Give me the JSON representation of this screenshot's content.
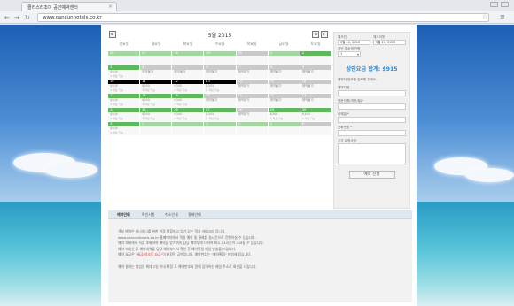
{
  "browser": {
    "tab_title": "콜리스라조이 공인예약센터",
    "url": "www.cancunhotels.co.kr"
  },
  "calendar": {
    "title": "5월 2015",
    "prev_label": "◂",
    "next_label": "▸",
    "today_label": "▸",
    "days": [
      "일요일",
      "월요일",
      "화요일",
      "수요일",
      "목요일",
      "금요일",
      "토요일"
    ],
    "weeks": [
      [
        {
          "d": "26",
          "s": "lg",
          "a": "",
          "b": ""
        },
        {
          "d": "27",
          "s": "lg",
          "a": "",
          "b": ""
        },
        {
          "d": "28",
          "s": "lg",
          "a": "",
          "b": ""
        },
        {
          "d": "29",
          "s": "lg",
          "a": "",
          "b": ""
        },
        {
          "d": "30",
          "s": "",
          "a": "",
          "b": ""
        },
        {
          "d": "1",
          "s": "lg",
          "a": "",
          "b": ""
        },
        {
          "d": "2",
          "s": "g",
          "a": "",
          "b": ""
        }
      ],
      [
        {
          "d": "3",
          "s": "g",
          "a": "$305",
          "b": "3 객실 가능"
        },
        {
          "d": "4",
          "s": "",
          "a": "예약불가",
          "b": ""
        },
        {
          "d": "5",
          "s": "",
          "a": "예약불가",
          "b": ""
        },
        {
          "d": "6",
          "s": "",
          "a": "예약불가",
          "b": ""
        },
        {
          "d": "7",
          "s": "",
          "a": "예약불가",
          "b": ""
        },
        {
          "d": "8",
          "s": "",
          "a": "예약불가",
          "b": ""
        },
        {
          "d": "9",
          "s": "",
          "a": "예약불가",
          "b": ""
        }
      ],
      [
        {
          "d": "10",
          "s": "b",
          "a": "$305",
          "b": "3 객실 가능"
        },
        {
          "d": "11",
          "s": "b",
          "a": "$305",
          "b": "3 객실 가능"
        },
        {
          "d": "12",
          "s": "b",
          "a": "$305",
          "b": "3 객실 가능"
        },
        {
          "d": "13",
          "s": "b",
          "a": "$305",
          "b": "3 객실 가능"
        },
        {
          "d": "14",
          "s": "",
          "a": "예약불가",
          "b": ""
        },
        {
          "d": "15",
          "s": "",
          "a": "예약불가",
          "b": ""
        },
        {
          "d": "16",
          "s": "",
          "a": "예약불가",
          "b": ""
        }
      ],
      [
        {
          "d": "17",
          "s": "g",
          "a": "$305",
          "b": "3 객실 가능"
        },
        {
          "d": "18",
          "s": "g",
          "a": "$305",
          "b": "3 객실 가능"
        },
        {
          "d": "19",
          "s": "g",
          "a": "$305",
          "b": "3 객실 가능"
        },
        {
          "d": "20",
          "s": "",
          "a": "예약불가",
          "b": ""
        },
        {
          "d": "21",
          "s": "",
          "a": "예약불가",
          "b": ""
        },
        {
          "d": "22",
          "s": "",
          "a": "예약불가",
          "b": ""
        },
        {
          "d": "23",
          "s": "",
          "a": "예약불가",
          "b": ""
        }
      ],
      [
        {
          "d": "24",
          "s": "g",
          "a": "$305",
          "b": "3 객실 가능"
        },
        {
          "d": "25",
          "s": "g",
          "a": "$305",
          "b": "3 객실 가능"
        },
        {
          "d": "26",
          "s": "g",
          "a": "$305",
          "b": "3 객실 가능"
        },
        {
          "d": "27",
          "s": "g",
          "a": "$305",
          "b": "3 객실 가능"
        },
        {
          "d": "28",
          "s": "",
          "a": "예약불가",
          "b": ""
        },
        {
          "d": "29",
          "s": "g",
          "a": "$305",
          "b": "3 객실 가능"
        },
        {
          "d": "30",
          "s": "g",
          "a": "$305",
          "b": "3 객실 가능"
        }
      ],
      [
        {
          "d": "31",
          "s": "g",
          "a": "$305",
          "b": "3 객실 가능"
        },
        {
          "d": "1",
          "s": "lg",
          "a": "",
          "b": ""
        },
        {
          "d": "2",
          "s": "lg",
          "a": "",
          "b": ""
        },
        {
          "d": "3",
          "s": "lg",
          "a": "",
          "b": ""
        },
        {
          "d": "4",
          "s": "lg",
          "a": "",
          "b": ""
        },
        {
          "d": "5",
          "s": "lg",
          "a": "",
          "b": ""
        },
        {
          "d": "6",
          "s": "",
          "a": "",
          "b": ""
        }
      ]
    ]
  },
  "form": {
    "checkin_label": "체크인",
    "checkout_label": "체크아웃",
    "checkin_value": "5월 10, 2015",
    "checkout_value": "5월 13, 2015",
    "guests_label": "성인 투숙객 인원",
    "guests_value": "1",
    "total_text": "성인요금 합계: $915",
    "instruction": "예약자 정보를 입력해 주세요.",
    "fields": [
      "예약자명",
      "영문이름(여권/필)*",
      "이메일 *",
      "전화번호 *",
      "추가 요청사항"
    ],
    "submit_label": "예약 신청"
  },
  "info": {
    "tabs": [
      "예약안내",
      "확인사항",
      "취소안내",
      "결제안내"
    ],
    "paragraph1": [
      "객실 예약은 하나하나를 위한 가장 적합하고 있기 있는 객실 카테고리 입니다.",
      "www.cancunhotels.co.kr 홈페이지에서 객실 예약 및 결제를 실시간으로 진행하실 수 있습니다.",
      "예약 조회에서 직접 조회하여 예약을 받기까지 담당 예약부에 대하여 최소 24시간이 소요될 수 있습니다.",
      "예약 보내신 후 예약내역을 담당 예약부에서 확인 후 예약확정 메일 발송을 드립니다.",
      "예약 요금은 \"세금/리조트 요금\"이 포함된 금액입니다. 예약번호는 \"예약확정\" 메일에 있습니다."
    ],
    "paragraph1_red": "\"세금/리조트 요금\"",
    "paragraph2": "예약 결과는 영업일 최대 2일 이내 확정 후 예약번호와 함께 입력하신 메일 주소로 회신을 드립니다."
  },
  "colors": {
    "available": "#5fb85c",
    "available_light": "#a4d69f",
    "selected": "#000000",
    "unavailable": "#c9c9c9",
    "total_text": "#2a8bd8"
  }
}
